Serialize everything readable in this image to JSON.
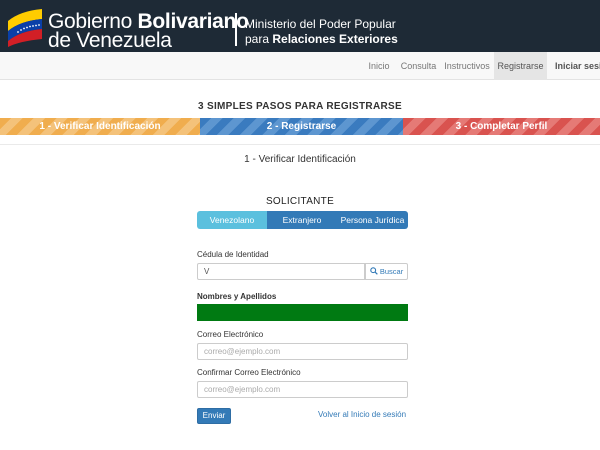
{
  "header": {
    "gov_line1_prefix": "Gobierno ",
    "gov_line1_bold": "Bolivariano",
    "gov_line2": "de Venezuela",
    "ministry_line1": "Ministerio del Poder Popular",
    "ministry_line2_prefix": "para ",
    "ministry_line2_bold": "Relaciones Exteriores"
  },
  "nav": {
    "items": [
      "Inicio",
      "Consulta",
      "Instructivos",
      "Registrarse",
      "Iniciar sesión"
    ],
    "active": "Registrarse"
  },
  "steps": {
    "title": "3 SIMPLES PASOS PARA REGISTRARSE",
    "items": [
      "1 - Verificar Identificación",
      "2 - Registrarse",
      "3 - Completar Perfil"
    ]
  },
  "form": {
    "section_title": "1 - Verificar Identificación",
    "solicitante": "SOLICITANTE",
    "types": [
      "Venezolano",
      "Extranjero",
      "Persona Jurídica"
    ],
    "selected_type": "Venezolano",
    "cedula_label": "Cédula de Identidad",
    "cedula_value": "V",
    "buscar_label": "Buscar",
    "nombres_label": "Nombres y Apellidos",
    "correo_label": "Correo Electrónico",
    "correo_placeholder": "correo@ejemplo.com",
    "confirmar_label": "Confirmar Correo Electrónico",
    "confirmar_placeholder": "correo@ejemplo.com",
    "enviar_label": "Enviar",
    "volver_label": "Volver al Inicio de sesión"
  },
  "colors": {
    "header_bg": "#1e2a36",
    "step1": "#f0ad4e",
    "step2": "#3a7bbf",
    "step3": "#d9534f",
    "primary": "#337ab7",
    "selected_tab": "#5bc0de",
    "nombres_fill": "#007a12"
  },
  "icons": [
    "venezuela-flag-icon",
    "search-icon"
  ]
}
